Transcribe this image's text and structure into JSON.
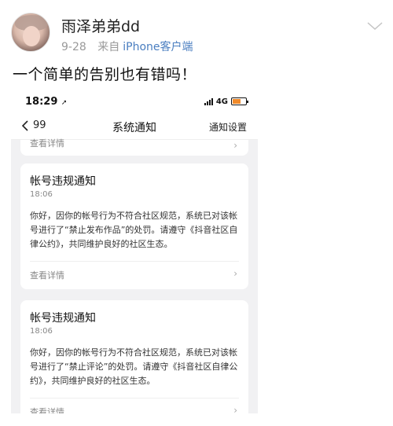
{
  "post": {
    "username": "雨泽弟弟dd",
    "date": "9-28",
    "from_label": "来自",
    "source": "iPhone客户端",
    "text": "一个简单的告别也有错吗！"
  },
  "phone": {
    "status_time": "18:29",
    "network": "4G",
    "nav_back_count": "99",
    "nav_title": "系统通知",
    "nav_settings": "通知设置",
    "partial_view_label": "查看详情",
    "notifications": [
      {
        "title": "帐号违规通知",
        "time": "18:06",
        "body": "你好，因你的帐号行为不符合社区规范，系统已对该帐号进行了“禁止发布作品”的处罚。请遵守《抖音社区自律公约》，共同维护良好的社区生态。",
        "view_label": "查看详情"
      },
      {
        "title": "帐号违规通知",
        "time": "18:06",
        "body": "你好，因你的帐号行为不符合社区规范，系统已对该帐号进行了“禁止评论”的处罚。请遵守《抖音社区自律公约》，共同维护良好的社区生态。",
        "view_label": "查看详情"
      }
    ]
  }
}
